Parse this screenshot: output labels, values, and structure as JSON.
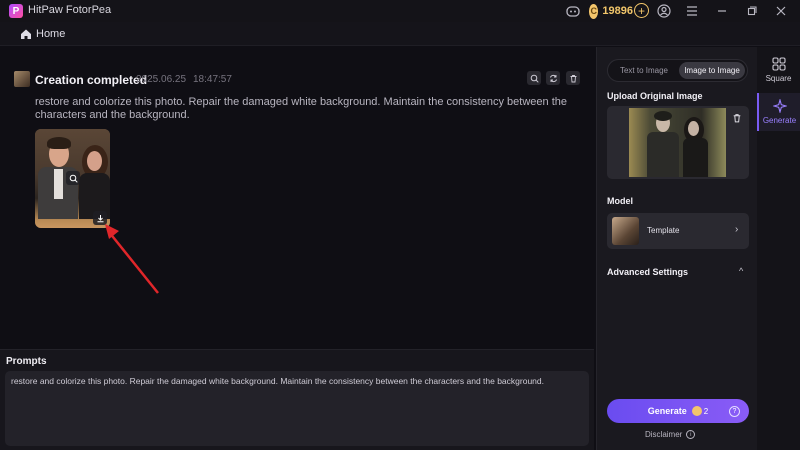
{
  "titlebar": {
    "app_name": "HitPaw FotorPea",
    "coins": "19896",
    "icons": [
      "discord-icon",
      "coin-icon",
      "plus-icon",
      "user-icon",
      "menu-icon",
      "minimize-icon",
      "maximize-icon",
      "close-icon"
    ]
  },
  "nav": {
    "home_label": "Home"
  },
  "creation": {
    "title": "Creation completed",
    "date": "2025.06.25",
    "time": "18:47:57",
    "prompt": "restore and colorize this photo. Repair the damaged white background. Maintain the consistency between the characters and the background."
  },
  "prompts_panel": {
    "title": "Prompts",
    "text": "restore and colorize this photo. Repair the damaged white background. Maintain the consistency between the characters and the background."
  },
  "side_panel": {
    "mode_tabs": [
      "Text to Image",
      "Image to Image"
    ],
    "active_mode": "Image to Image",
    "upload_title": "Upload Original Image",
    "model_title": "Model",
    "model_value": "Template",
    "advanced_title": "Advanced Settings",
    "generate_label": "Generate",
    "generate_cost": "2",
    "disclaimer": "Disclaimer"
  },
  "rail": {
    "items": [
      {
        "label": "Square"
      },
      {
        "label": "Generate"
      }
    ]
  },
  "colors": {
    "accent": "#7a5cf4",
    "coin": "#f2c66a",
    "annotation_arrow": "#e0262a"
  }
}
